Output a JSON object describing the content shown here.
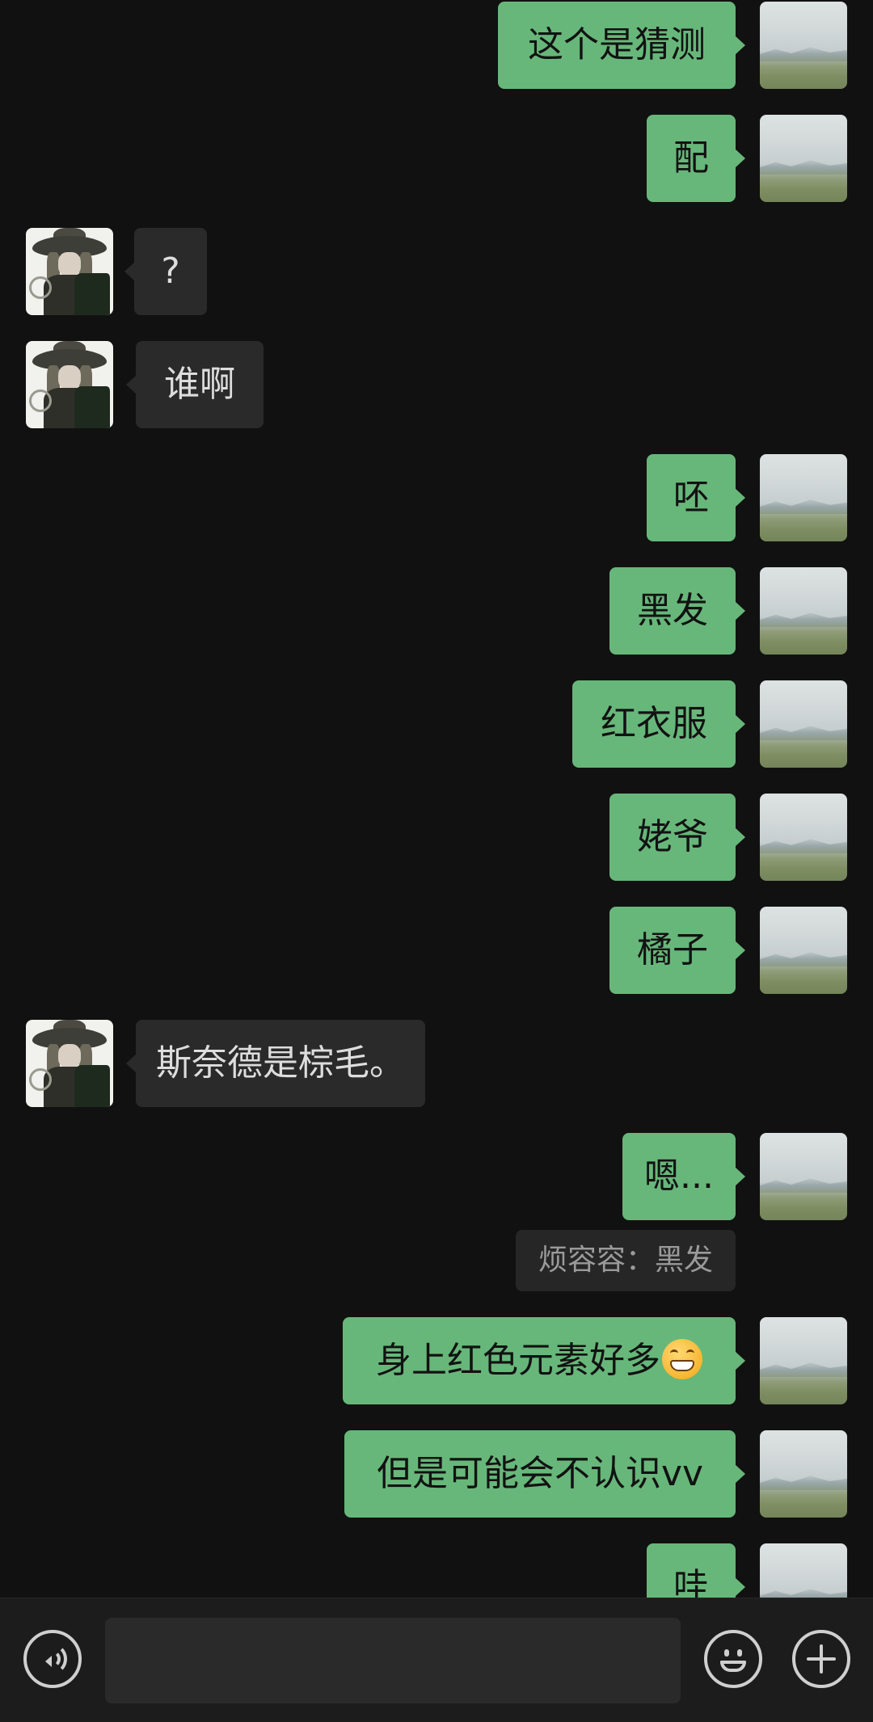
{
  "colors": {
    "background": "#111111",
    "my_bubble": "#67b77a",
    "their_bubble": "#2a2a2a",
    "input_bar": "#1c1c1c"
  },
  "messages": [
    {
      "sender": "me",
      "text": "这个是猜测"
    },
    {
      "sender": "me",
      "text": "配"
    },
    {
      "sender": "them",
      "text": "?"
    },
    {
      "sender": "them",
      "text": "谁啊"
    },
    {
      "sender": "me",
      "text": "呸"
    },
    {
      "sender": "me",
      "text": "黑发"
    },
    {
      "sender": "me",
      "text": "红衣服"
    },
    {
      "sender": "me",
      "text": "姥爷"
    },
    {
      "sender": "me",
      "text": "橘子"
    },
    {
      "sender": "them",
      "text": "斯奈德是棕毛。"
    },
    {
      "sender": "me",
      "text": "嗯..."
    },
    {
      "sender": "me",
      "text": "身上红色元素好多",
      "emoji": "grinning-face-emoji"
    },
    {
      "sender": "me",
      "text": "但是可能会不认识vv"
    },
    {
      "sender": "me",
      "text": "哇"
    }
  ],
  "quote": {
    "text": "烦容容：黑发"
  },
  "input_bar": {
    "input_value": "",
    "icons": [
      "voice-icon",
      "emoji-icon",
      "plus-icon"
    ]
  }
}
